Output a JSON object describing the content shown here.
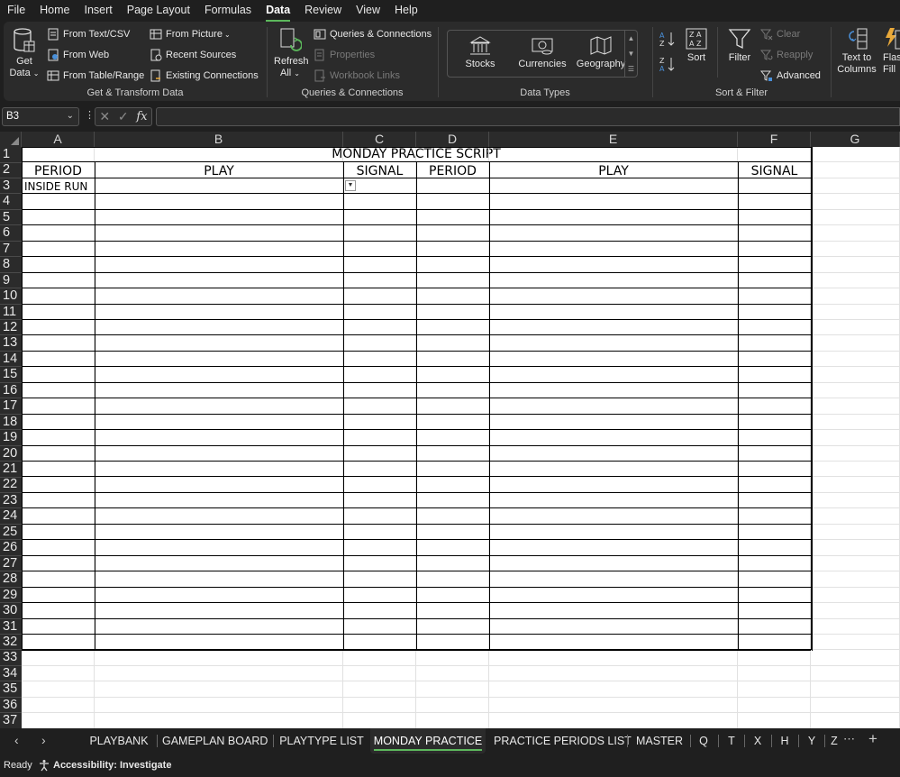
{
  "menu": [
    "File",
    "Home",
    "Insert",
    "Page Layout",
    "Formulas",
    "Data",
    "Review",
    "View",
    "Help"
  ],
  "active_menu": "Data",
  "ribbon": {
    "get_transform": {
      "get_data": "Get",
      "get_data2": "Data",
      "from_text_csv": "From Text/CSV",
      "from_web": "From Web",
      "from_table_range": "From Table/Range",
      "from_picture": "From Picture",
      "recent_sources": "Recent Sources",
      "existing_connections": "Existing Connections",
      "label": "Get & Transform Data"
    },
    "queries": {
      "refresh": "Refresh",
      "refresh2": "All",
      "queries_connections": "Queries & Connections",
      "properties": "Properties",
      "workbook_links": "Workbook Links",
      "label": "Queries & Connections"
    },
    "data_types": {
      "stocks": "Stocks",
      "currencies": "Currencies",
      "geography": "Geography",
      "label": "Data Types"
    },
    "sort_filter": {
      "sort": "Sort",
      "filter": "Filter",
      "clear": "Clear",
      "reapply": "Reapply",
      "advanced": "Advanced",
      "label": "Sort & Filter"
    },
    "data_tools": {
      "text_to": "Text to",
      "columns": "Columns",
      "flash": "Flas",
      "flash2": "Fill"
    }
  },
  "formula_bar": {
    "name_box": "B3",
    "fx": "fx",
    "value": ""
  },
  "columns": [
    "A",
    "B",
    "C",
    "D",
    "E",
    "F",
    "G"
  ],
  "rows": [
    "1",
    "2",
    "3",
    "4",
    "5",
    "6",
    "7",
    "8",
    "9",
    "10",
    "11",
    "12",
    "13",
    "14",
    "15",
    "16",
    "17",
    "18",
    "19",
    "20",
    "21",
    "22",
    "23",
    "24",
    "25",
    "26",
    "27",
    "28",
    "29",
    "30",
    "31",
    "32",
    "33",
    "34",
    "35",
    "36",
    "37"
  ],
  "sheet": {
    "title": "MONDAY PRACTICE SCRIPT",
    "headers": [
      "PERIOD",
      "PLAY",
      "SIGNAL",
      "PERIOD",
      "PLAY",
      "SIGNAL"
    ],
    "a3": "INSIDE RUN"
  },
  "tabs": [
    "PLAYBANK",
    "GAMEPLAN BOARD",
    "PLAYTYPE LIST",
    "MONDAY PRACTICE",
    "PRACTICE PERIODS LIST",
    "MASTER",
    "Q",
    "T",
    "X",
    "H",
    "Y",
    "Z"
  ],
  "active_tab": "MONDAY PRACTICE",
  "status": {
    "ready": "Ready",
    "accessibility": "Accessibility: Investigate"
  }
}
